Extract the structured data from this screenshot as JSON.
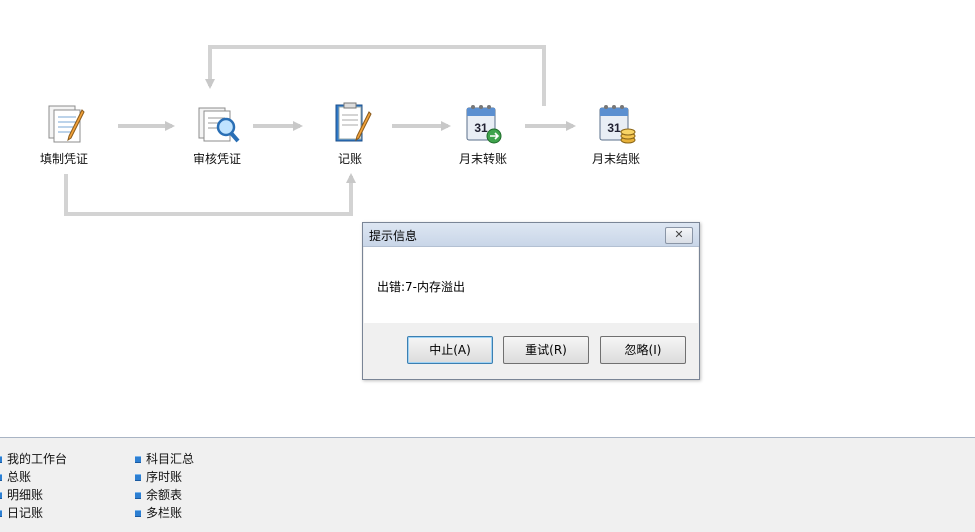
{
  "workflow": {
    "nodes": [
      {
        "label": "填制凭证",
        "icon": "document-pencil-icon"
      },
      {
        "label": "审核凭证",
        "icon": "document-magnifier-icon"
      },
      {
        "label": "记账",
        "icon": "ledger-pencil-icon"
      },
      {
        "label": "月末转账",
        "icon": "calendar-transfer-icon"
      },
      {
        "label": "月末结账",
        "icon": "calendar-coins-icon"
      }
    ]
  },
  "dialog": {
    "title": "提示信息",
    "message": "出错:7-内存溢出",
    "buttons": {
      "abort": "中止(A)",
      "retry": "重试(R)",
      "ignore": "忽略(I)"
    }
  },
  "panel": {
    "col1": [
      "我的工作台",
      "总账",
      "明细账",
      "日记账"
    ],
    "col2": [
      "科目汇总",
      "序时账",
      "余额表",
      "多栏账"
    ]
  },
  "colors": {
    "arrow": "#c8c8c8",
    "bullet": "#2d7fd2",
    "panel_border": "#a9b4c4"
  }
}
